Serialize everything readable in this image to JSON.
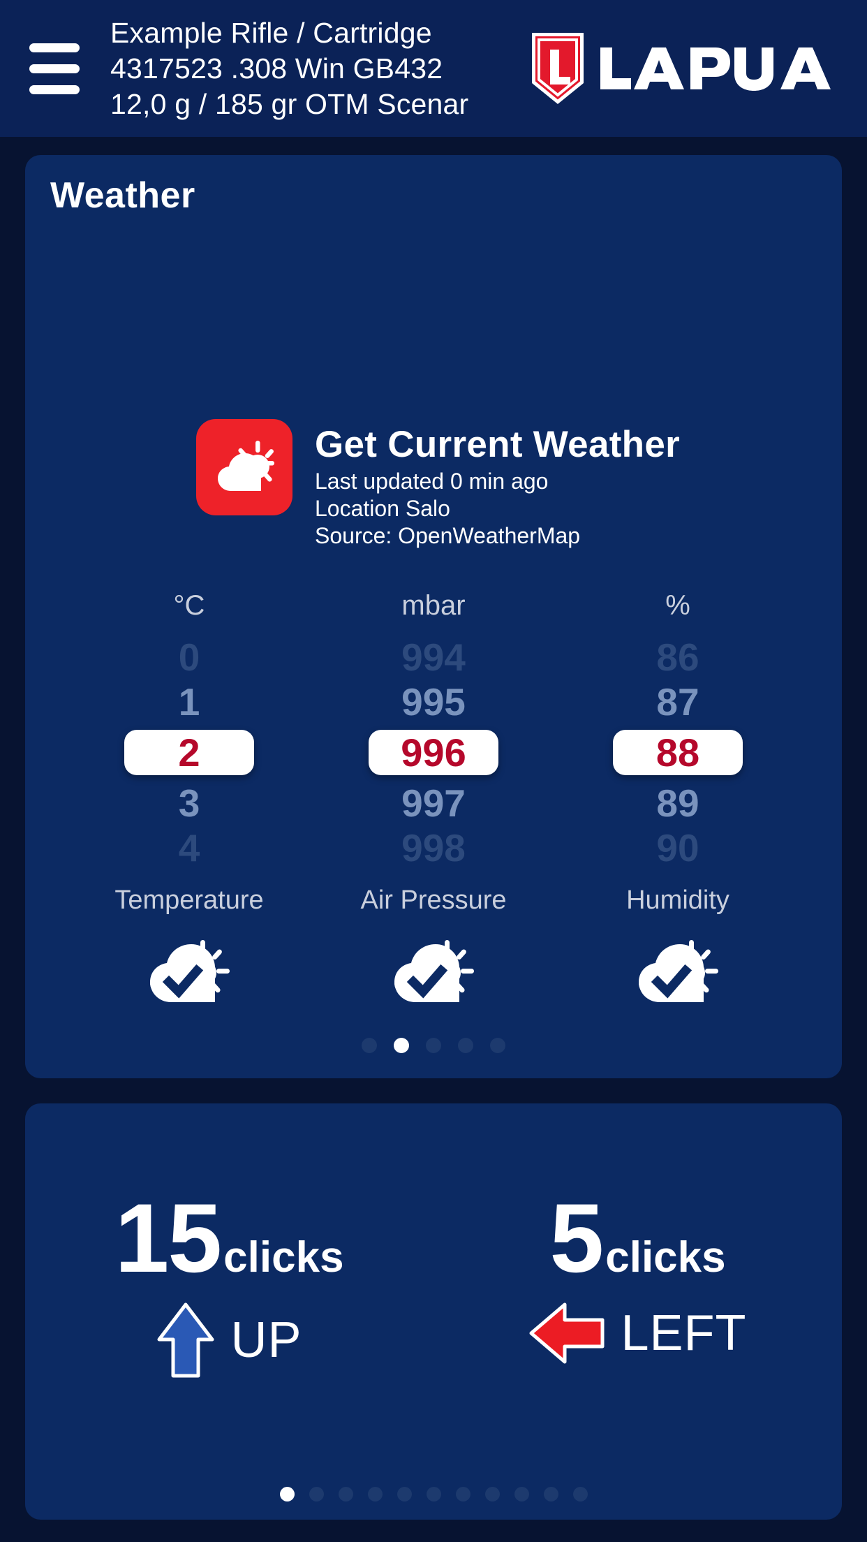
{
  "header": {
    "menu_icon": "hamburger-menu-icon",
    "title_lines": [
      "Example Rifle / Cartridge",
      "4317523 .308 Win GB432",
      "12,0 g / 185 gr  OTM Scenar"
    ],
    "brand": "LAPUA",
    "brand_mark": "lapua-shield-icon"
  },
  "weather_card": {
    "title": "Weather",
    "app_icon": "cloud-sun-icon",
    "action_title": "Get Current Weather",
    "last_updated": "Last updated 0 min ago",
    "location": "Location Salo",
    "source": "Source: OpenWeatherMap",
    "pickers": [
      {
        "unit": "°C",
        "label": "Temperature",
        "above_far": "0",
        "above_near": "1",
        "selected": "2",
        "below_near": "3",
        "below_far": "4",
        "status_icon": "cloud-sun-check-icon"
      },
      {
        "unit": "mbar",
        "label": "Air Pressure",
        "above_far": "994",
        "above_near": "995",
        "selected": "996",
        "below_near": "997",
        "below_far": "998",
        "status_icon": "cloud-sun-check-icon"
      },
      {
        "unit": "%",
        "label": "Humidity",
        "above_far": "86",
        "above_near": "87",
        "selected": "88",
        "below_near": "89",
        "below_far": "90",
        "status_icon": "cloud-sun-check-icon"
      }
    ],
    "pagination": {
      "count": 5,
      "active_index": 1
    }
  },
  "clicks_card": {
    "adjustments": [
      {
        "count": "15",
        "unit": "clicks",
        "direction": "UP",
        "arrow_icon": "arrow-up-icon",
        "arrow_color": "#2a59b5"
      },
      {
        "count": "5",
        "unit": "clicks",
        "direction": "LEFT",
        "arrow_icon": "arrow-left-icon",
        "arrow_color": "#ec1c24"
      }
    ],
    "pagination": {
      "count": 11,
      "active_index": 0
    }
  },
  "colors": {
    "page_background": "#071331",
    "card_background": "#0c2a63",
    "header_background": "#0b2257",
    "brand_red": "#ee2229",
    "selected_value_red": "#b5082b",
    "muted_text": "#c9cfdd"
  }
}
